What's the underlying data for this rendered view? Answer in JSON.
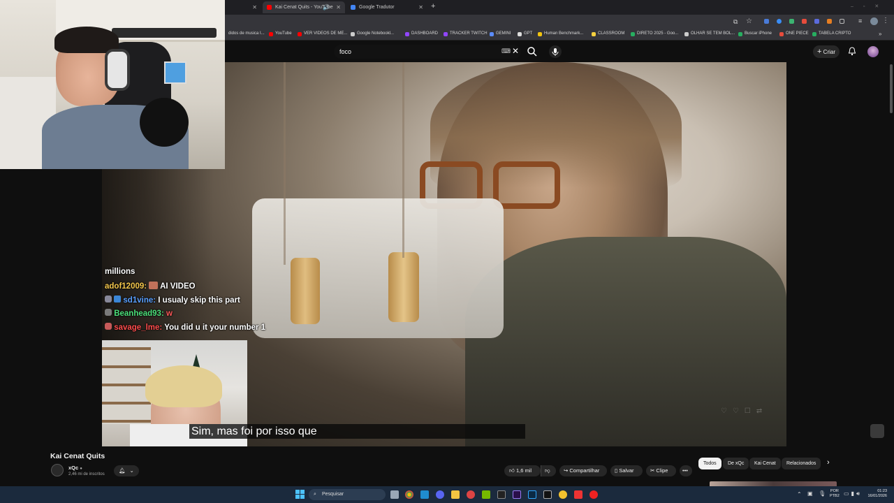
{
  "browser": {
    "tabs": [
      {
        "label": "Kai Cenat Quits - YouTube",
        "active": true
      },
      {
        "label": "Google Tradutor",
        "active": false
      }
    ],
    "bookmarks": [
      "didos de musica I...",
      "YouTube",
      "VER VIDEOS DE ME...",
      "Google Notebookl...",
      "DASHBOARD",
      "TRACKER TWITCH",
      "GEMINI",
      "GPT",
      "Human Benchmark...",
      "CLASSROOM",
      "DIRETO 2025 - Goo...",
      "OLHAR SE TEM BOL...",
      "Buscar iPhone",
      "ONE PIECE",
      "TABELA CRIPTO"
    ]
  },
  "youtube": {
    "search_value": "foco",
    "create_label": "Criar"
  },
  "stream": {
    "chat": [
      {
        "user": "",
        "message": "millions"
      },
      {
        "user": "adof12009:",
        "message": "AI VIDEO"
      },
      {
        "user": "sd1vine:",
        "message": "I usualy skip this part"
      },
      {
        "user": "Beanhead93:",
        "message": "w"
      },
      {
        "user": "savage_lme:",
        "message": "You did u it your number 1"
      }
    ],
    "subtitle": "Sim, mas foi por isso que"
  },
  "video": {
    "title": "Kai Cenat Quits",
    "channel": "xQc",
    "subscribers": "2,46 mi de inscritos",
    "likes": "1,6 mil",
    "share_label": "Compartilhar",
    "save_label": "Salvar",
    "clip_label": "Clipe"
  },
  "chips": [
    "Todos",
    "De xQc",
    "Kai Cenat",
    "Relacionados"
  ],
  "taskbar": {
    "search_label": "Pesquisar",
    "lang_top": "POR",
    "lang_bottom": "PTB2",
    "time": "01:23",
    "date": "16/01/2026"
  },
  "colors": {
    "yt_red": "#ff0000",
    "chat_user_1": "#f5c84c",
    "chat_user_2": "#5aa0ff",
    "chat_user_3": "#4ce07a",
    "chat_user_4": "#ff4d4d"
  }
}
